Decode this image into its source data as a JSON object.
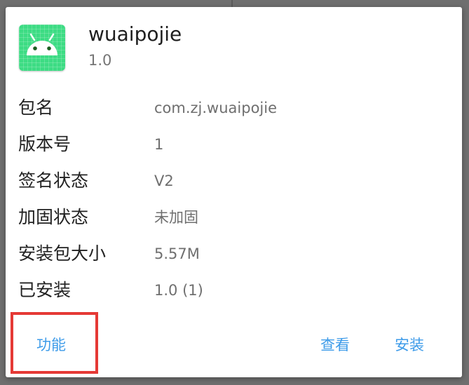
{
  "app": {
    "name": "wuaipojie",
    "version": "1.0"
  },
  "icon": {
    "name": "android-robot-icon",
    "background": "#3ddc84"
  },
  "info_rows": [
    {
      "label": "包名",
      "value": "com.zj.wuaipojie"
    },
    {
      "label": "版本号",
      "value": "1"
    },
    {
      "label": "签名状态",
      "value": "V2"
    },
    {
      "label": "加固状态",
      "value": "未加固"
    },
    {
      "label": "安装包大小",
      "value": "5.57M"
    },
    {
      "label": "已安装",
      "value": "1.0 (1)"
    }
  ],
  "actions": {
    "function_label": "功能",
    "view_label": "查看",
    "install_label": "安装"
  },
  "colors": {
    "accent": "#3d9be9",
    "highlight": "#e53935",
    "scrim": "#6f6f6f"
  }
}
